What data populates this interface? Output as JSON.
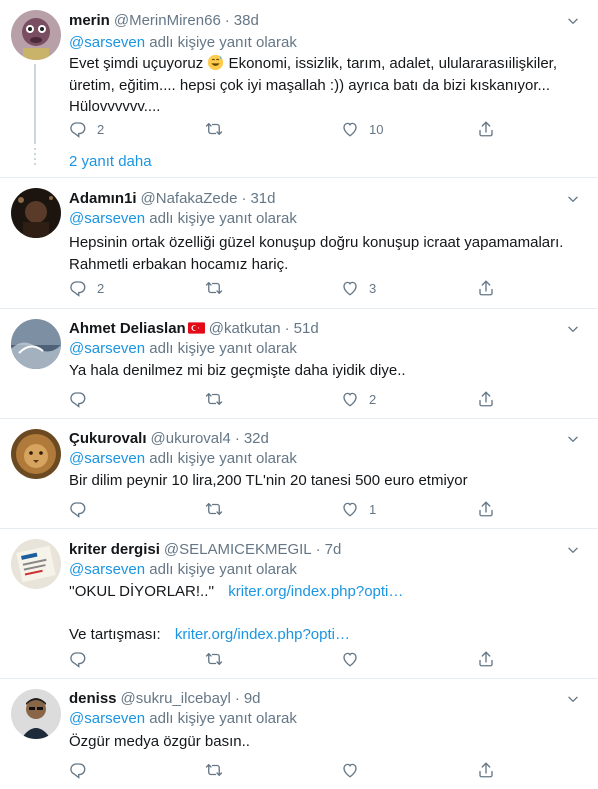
{
  "tweets": [
    {
      "name": "merin",
      "handle": "@MerinMiren66",
      "time": "38d",
      "reply_prefix": "@sarseven",
      "reply_suffix": "adlı kişiye yanıt olarak",
      "text_before_emoji": "Evet şimdi uçuyoruz ",
      "emoji": "grinning-sweat-emoji",
      "text_after_emoji": " Ekonomi, issizlik, tarım, adalet, ululararasıilişkiler, üretim, eğitim.... hepsi çok iyi maşallah :)) ayrıca batı da bizi kıskanıyor... Hülovvvvvv....",
      "replies": "2",
      "retweets": "",
      "likes": "10",
      "more_replies": "2 yanıt daha"
    },
    {
      "name": "Adamın1i",
      "handle": "@NafakaZede",
      "time": "31d",
      "reply_prefix": "@sarseven",
      "reply_suffix": "adlı kişiye yanıt olarak",
      "text": "Hepsinin ortak özelliği güzel konuşup doğru konuşup icraat yapamamaları. Rahmetli erbakan hocamız hariç.",
      "replies": "2",
      "retweets": "",
      "likes": "3"
    },
    {
      "name": "Ahmet Deliaslan",
      "flag": "turkey-flag-icon",
      "handle": "@katkutan",
      "time": "51d",
      "reply_prefix": "@sarseven",
      "reply_suffix": "adlı kişiye yanıt olarak",
      "text": "Ya hala denilmez mi biz geçmişte daha iyidik diye..",
      "replies": "",
      "retweets": "",
      "likes": "2"
    },
    {
      "name": "Çukurovalı",
      "handle": "@ukuroval4",
      "time": "32d",
      "reply_prefix": "@sarseven",
      "reply_suffix": "adlı kişiye yanıt olarak",
      "text": "Bir dilim peynir 10 lira,200 TL'nin 20 tanesi 500 euro etmiyor",
      "replies": "",
      "retweets": "",
      "likes": "1"
    },
    {
      "name": "kriter dergisi",
      "handle": "@SELAMICEKMEGIL",
      "time": "7d",
      "reply_prefix": "@sarseven",
      "reply_suffix": "adlı kişiye yanıt olarak",
      "line1_text": "''OKUL DİYORLAR!..''",
      "line1_link": "kriter.org/index.php?opti…",
      "line2_text": "Ve tartışması:",
      "line2_link": "kriter.org/index.php?opti…",
      "replies": "",
      "retweets": "",
      "likes": ""
    },
    {
      "name": "deniss",
      "handle": "@sukru_ilcebayl",
      "time": "9d",
      "reply_prefix": "@sarseven",
      "reply_suffix": "adlı kişiye yanıt olarak",
      "text": "Özgür medya özgür basın..",
      "replies": "",
      "retweets": "",
      "likes": ""
    }
  ],
  "separator": "·",
  "colors": {
    "accent": "#1b95e0",
    "muted": "#657786",
    "border": "#e6ecf0"
  }
}
